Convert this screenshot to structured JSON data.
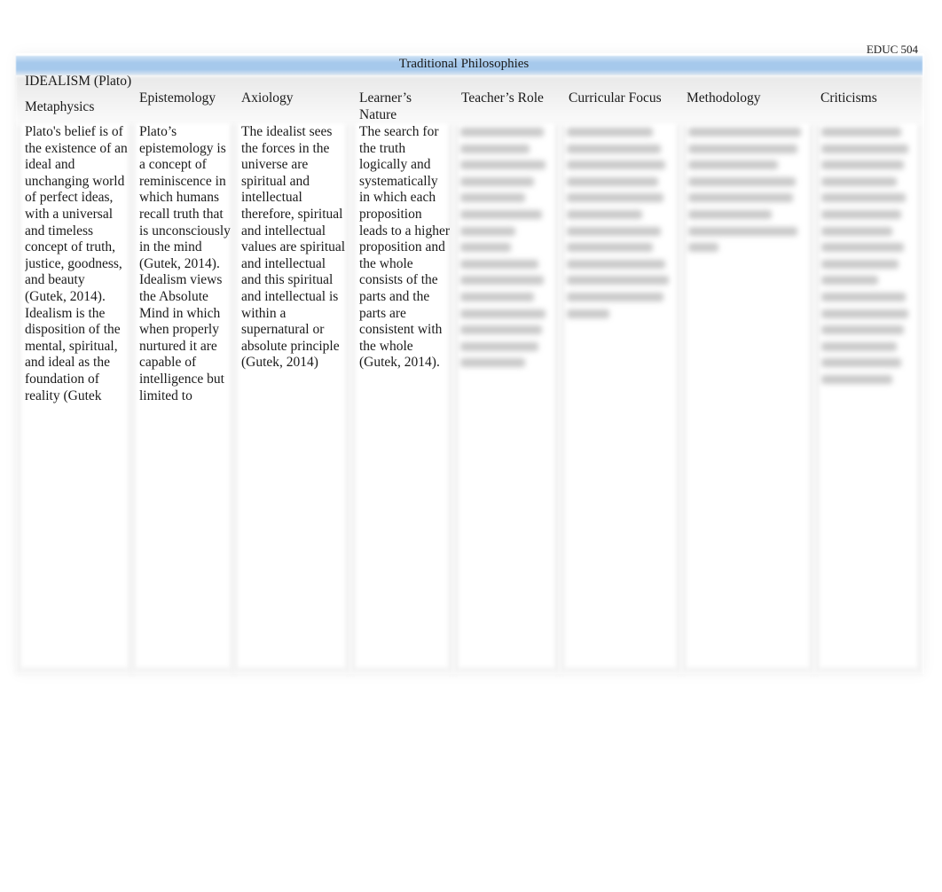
{
  "document": {
    "course_code": "EDUC 504",
    "table_title": "Traditional Philosophies",
    "philosophy_label": "IDEALISM (Plato)"
  },
  "columns": [
    {
      "label": "Metaphysics"
    },
    {
      "label": "Epistemology"
    },
    {
      "label": "Axiology"
    },
    {
      "label": "Learner’s Nature"
    },
    {
      "label": "Teacher’s Role"
    },
    {
      "label": "Curricular Focus"
    },
    {
      "label": "Methodology"
    },
    {
      "label": "Criticisms"
    }
  ],
  "cells": {
    "metaphysics": "Plato's belief is of the existence of an ideal and unchanging world of perfect ideas, with a universal and timeless concept of truth, justice, goodness, and beauty (Gutek, 2014). Idealism is the disposition of the mental, spiritual, and ideal as the foundation of reality (Gutek",
    "epistemology": "Plato’s epistemology is a concept of reminiscence in which humans recall truth that is unconsciously in the mind (Gutek, 2014). Idealism views the Absolute Mind in which when properly nurtured it are capable of intelligence but limited to",
    "axiology": "The idealist sees the forces in the universe are spiritual and intellectual therefore, spiritual and intellectual values are spiritual and intellectual and this spiritual and intellectual is within a supernatural or absolute principle (Gutek, 2014)",
    "learners_nature": "The search for the truth logically and systematically in which each proposition leads to a higher proposition and the whole consists of the parts and the parts are consistent with the whole (Gutek, 2014).",
    "teachers_role": "[blurred]",
    "curricular_focus": "[blurred]",
    "methodology": "[blurred]",
    "criticisms": "[blurred]"
  }
}
